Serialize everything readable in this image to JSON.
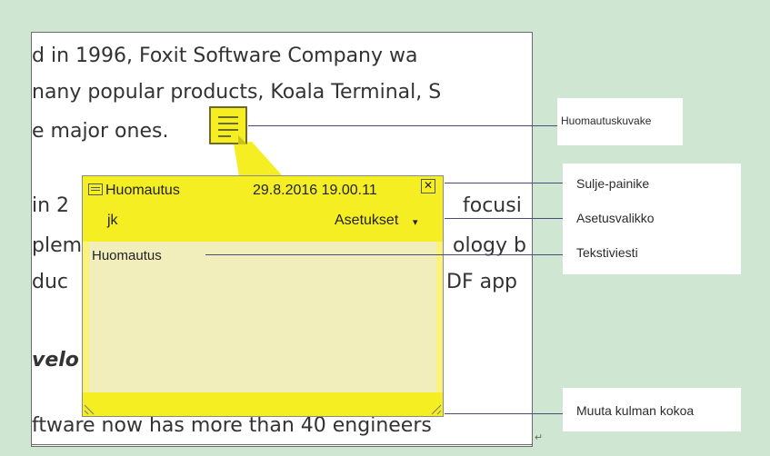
{
  "document": {
    "lines": [
      "d in 1996, Foxit Software Company wa",
      "nany popular products, Koala Terminal, S",
      "e major ones.",
      "in 2",
      "focusi",
      "plem",
      "ology b",
      "duc",
      "DF app",
      "velo",
      "ftware now has more than 40 engineers"
    ],
    "return_mark": "↵"
  },
  "note_popup": {
    "type_label": "Huomautus",
    "datetime": "29.8.2016 19.00.11",
    "author": "jk",
    "options_label": "Asetukset",
    "options_arrow": "▾",
    "close_glyph": "✕",
    "body_text": "Huomautus"
  },
  "callouts": {
    "note_icon": "Huomautuskuvake",
    "close_button": "Sulje-painike",
    "options_menu": "Asetusvalikko",
    "text_message": "Tekstiviesti",
    "resize_corner": "Muuta kulman kokoa"
  },
  "colors": {
    "background": "#cfe6d3",
    "note_yellow": "#f5ee23",
    "note_body": "#f1eebc",
    "connector": "#4b4b78"
  }
}
